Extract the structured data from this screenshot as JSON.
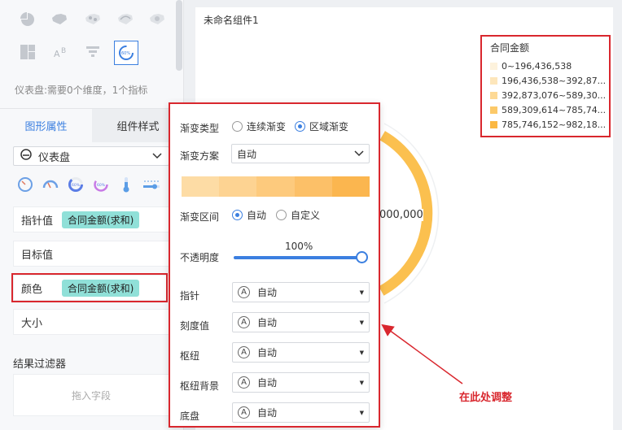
{
  "left_panel": {
    "hint": "仪表盘:需要0个维度，1个指标",
    "tabs": [
      {
        "label": "图形属性",
        "active": true
      },
      {
        "label": "组件样式",
        "active": false
      }
    ],
    "chart_type": "仪表盘",
    "fields": {
      "pointer_label": "指针值",
      "pointer_chip": "合同金额(求和)",
      "target_label": "目标值",
      "color_label": "颜色",
      "color_chip": "合同金额(求和)",
      "size_label": "大小"
    },
    "filter_title": "结果过滤器",
    "drop_placeholder": "拖入字段"
  },
  "canvas": {
    "widget_title": "未命名组件1",
    "gauge_value_text": "000,000",
    "legend": {
      "title": "合同金额",
      "items": [
        {
          "label": "0~196,436,538",
          "color": "#fdf2dc"
        },
        {
          "label": "196,436,538~392,87...",
          "color": "#fde6bb"
        },
        {
          "label": "392,873,076~589,30...",
          "color": "#fdd995"
        },
        {
          "label": "589,309,614~785,74...",
          "color": "#fcc969"
        },
        {
          "label": "785,746,152~982,18...",
          "color": "#fbb843"
        }
      ]
    }
  },
  "popup": {
    "gradient_type_label": "渐变类型",
    "gradient_options": [
      {
        "label": "连续渐变",
        "selected": false
      },
      {
        "label": "区域渐变",
        "selected": true
      }
    ],
    "scheme_label": "渐变方案",
    "scheme_value": "自动",
    "gradient_colors": [
      "#fddca5",
      "#fdd392",
      "#fdca7d",
      "#fcc068",
      "#fbb64f"
    ],
    "range_label": "渐变区间",
    "range_options": [
      {
        "label": "自动",
        "selected": true
      },
      {
        "label": "自定义",
        "selected": false
      }
    ],
    "opacity_label": "不透明度",
    "opacity_value": "100%",
    "opacity_fraction": 1.0,
    "settings": [
      {
        "label": "指针",
        "value": "自动"
      },
      {
        "label": "刻度值",
        "value": "自动"
      },
      {
        "label": "枢纽",
        "value": "自动"
      },
      {
        "label": "枢纽背景",
        "value": "自动"
      },
      {
        "label": "底盘",
        "value": "自动"
      }
    ],
    "auto_icon_glyph": "A"
  },
  "annotation": {
    "text": "在此处调整"
  },
  "colors": {
    "accent": "#3b7fe0",
    "highlight": "#d9272e",
    "chip": "#90e0d8",
    "gauge": "#fbc04f"
  }
}
